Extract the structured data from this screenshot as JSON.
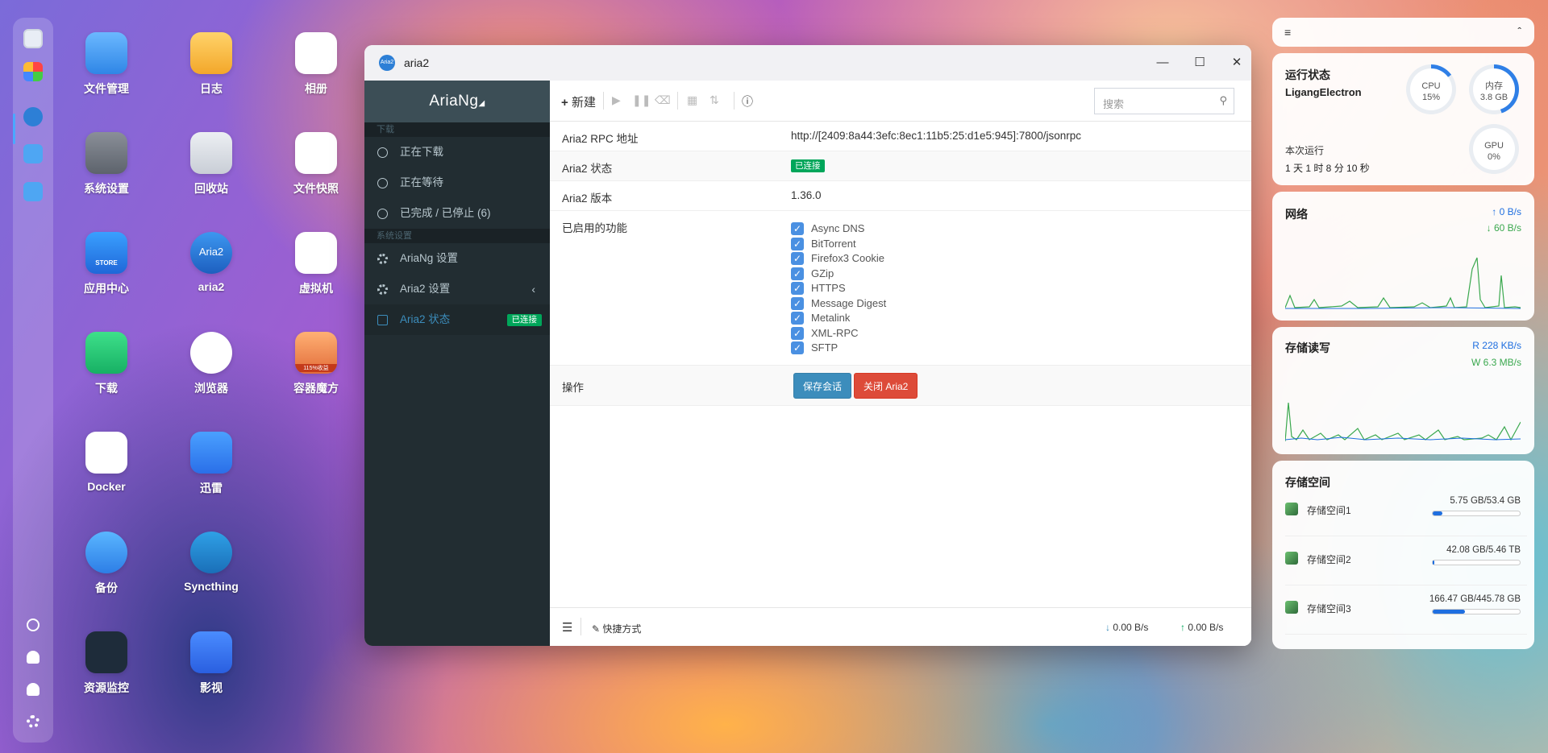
{
  "desktop": {
    "icons": [
      {
        "label": "文件管理",
        "icon": "folder-icon"
      },
      {
        "label": "日志",
        "icon": "log-icon"
      },
      {
        "label": "相册",
        "icon": "photos-icon"
      },
      {
        "label": "系统设置",
        "icon": "gear-icon"
      },
      {
        "label": "回收站",
        "icon": "recycle-icon"
      },
      {
        "label": "文件快照",
        "icon": "snapshot-icon"
      },
      {
        "label": "应用中心",
        "icon": "store-icon"
      },
      {
        "label": "aria2",
        "icon": "aria2-icon"
      },
      {
        "label": "虚拟机",
        "icon": "vm-icon"
      },
      {
        "label": "下载",
        "icon": "download-icon"
      },
      {
        "label": "浏览器",
        "icon": "browser-icon"
      },
      {
        "label": "容器魔方",
        "icon": "container-icon"
      },
      {
        "label": "Docker",
        "icon": "docker-icon"
      },
      {
        "label": "迅雷",
        "icon": "thunder-icon"
      },
      {
        "label": "备份",
        "icon": "backup-icon"
      },
      {
        "label": "Syncthing",
        "icon": "syncthing-icon"
      },
      {
        "label": "资源监控",
        "icon": "monitor-icon"
      },
      {
        "label": "影视",
        "icon": "video-icon"
      }
    ],
    "store_badge": "STORE",
    "container_badge": "115%收益",
    "aria_logo": "Aria2"
  },
  "window": {
    "title": "aria2",
    "logo_text": "Aria2",
    "controls": {
      "minimize": "—",
      "maximize": "☐",
      "close": "✕"
    }
  },
  "sidebar": {
    "brand": "AriaNg",
    "section_download": "下载",
    "section_settings": "系统设置",
    "items": [
      {
        "label": "正在下载"
      },
      {
        "label": "正在等待"
      },
      {
        "label": "已完成 / 已停止 (6)"
      },
      {
        "label": "AriaNg 设置"
      },
      {
        "label": "Aria2 设置"
      },
      {
        "label": "Aria2 状态",
        "badge": "已连接"
      }
    ]
  },
  "toolbar": {
    "new_label": "新建",
    "search_placeholder": "搜索"
  },
  "status": {
    "rows": [
      {
        "key": "Aria2 RPC 地址",
        "value": "http://[2409:8a44:3efc:8ec1:11b5:25:d1e5:945]:7800/jsonrpc"
      },
      {
        "key": "Aria2 状态",
        "value": "已连接"
      },
      {
        "key": "Aria2 版本",
        "value": "1.36.0"
      },
      {
        "key": "已启用的功能",
        "value": ""
      },
      {
        "key": "操作",
        "value": ""
      }
    ],
    "features": [
      "Async DNS",
      "BitTorrent",
      "Firefox3 Cookie",
      "GZip",
      "HTTPS",
      "Message Digest",
      "Metalink",
      "XML-RPC",
      "SFTP"
    ],
    "save_session": "保存会话",
    "shutdown": "关闭 Aria2"
  },
  "footer": {
    "shortcut": "快捷方式",
    "download_speed": "0.00 B/s",
    "upload_speed": "0.00 B/s"
  },
  "widgets": {
    "runtime": {
      "title": "运行状态",
      "host": "LigangElectron",
      "uptime_label": "本次运行",
      "uptime": "1 天 1 时 8 分 10 秒",
      "cpu_label": "CPU",
      "cpu_value": "15%",
      "cpu_fraction": 0.15,
      "mem_label": "内存",
      "mem_value": "3.8 GB",
      "mem_fraction": 0.45,
      "gpu_label": "GPU",
      "gpu_value": "0%",
      "gpu_fraction": 0.0
    },
    "network": {
      "title": "网络",
      "up": "0 B/s",
      "down": "60 B/s"
    },
    "disk_io": {
      "title": "存储读写",
      "read": "R 228 KB/s",
      "write": "W 6.3 MB/s"
    },
    "storage": {
      "title": "存储空间",
      "volumes": [
        {
          "name": "存储空间1",
          "used": "5.75 GB/53.4 GB",
          "fraction": 0.11
        },
        {
          "name": "存储空间2",
          "used": "42.08 GB/5.46 TB",
          "fraction": 0.01
        },
        {
          "name": "存储空间3",
          "used": "166.47 GB/445.78 GB",
          "fraction": 0.37
        }
      ]
    }
  },
  "colors": {
    "accent": "#3c8dbc",
    "success": "#00a65a",
    "danger": "#dd4b39",
    "sidebar": "#222d32"
  }
}
